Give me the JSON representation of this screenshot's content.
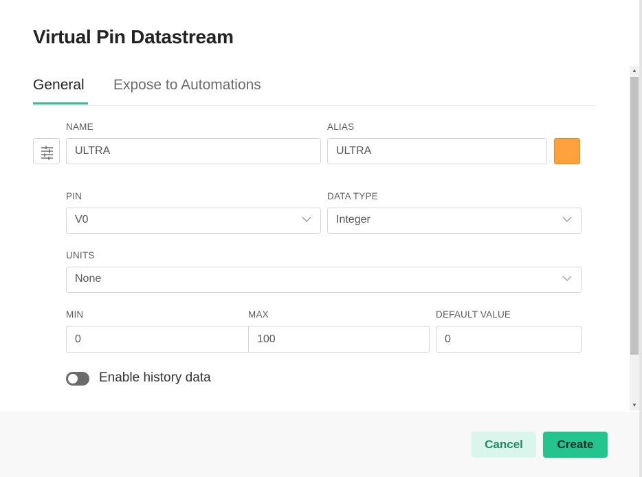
{
  "dialog": {
    "title": "Virtual Pin Datastream",
    "tabs": [
      {
        "label": "General",
        "active": true
      },
      {
        "label": "Expose to Automations",
        "active": false
      }
    ]
  },
  "form": {
    "name": {
      "label": "NAME",
      "value": "ULTRA"
    },
    "alias": {
      "label": "ALIAS",
      "value": "ULTRA"
    },
    "color": "#ffa23c",
    "pin": {
      "label": "PIN",
      "value": "V0"
    },
    "data_type": {
      "label": "DATA TYPE",
      "value": "Integer"
    },
    "units": {
      "label": "UNITS",
      "value": "None"
    },
    "min": {
      "label": "MIN",
      "value": "0"
    },
    "max": {
      "label": "MAX",
      "value": "100"
    },
    "default_value": {
      "label": "DEFAULT VALUE",
      "value": "0"
    },
    "history": {
      "label": "Enable history data",
      "enabled": false
    }
  },
  "footer": {
    "cancel_label": "Cancel",
    "create_label": "Create"
  },
  "colors": {
    "accent": "#23c48e",
    "accent_light": "#d9f5ec",
    "swatch": "#ffa23c"
  },
  "icons": {
    "settings_icon": "sliders-icon",
    "chevron": "chevron-down-icon"
  }
}
